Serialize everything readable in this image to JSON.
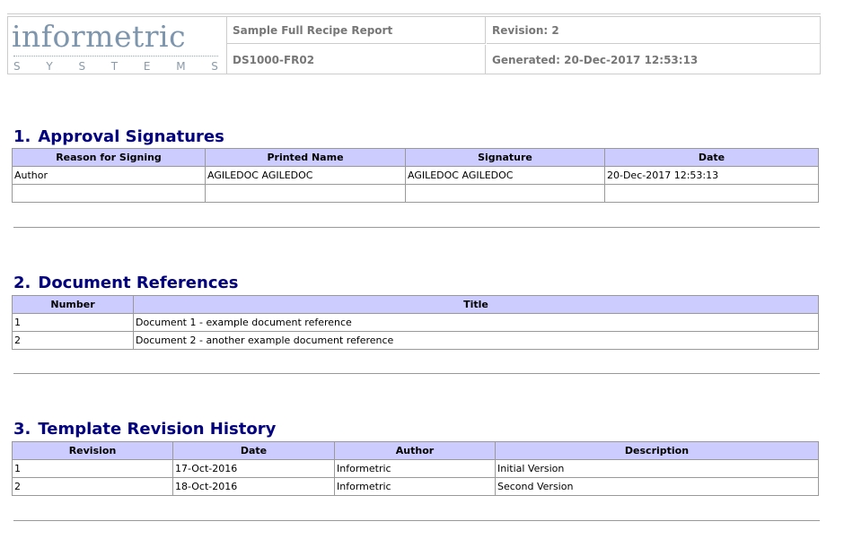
{
  "header": {
    "logo_word": "informetric",
    "logo_sub": [
      "S",
      "Y",
      "S",
      "T",
      "E",
      "M",
      "S"
    ],
    "report_title": "Sample Full Recipe Report",
    "revision": "Revision: 2",
    "doc_code": "DS1000-FR02",
    "generated": "Generated: 20-Dec-2017 12:53:13"
  },
  "sections": {
    "approval": {
      "number": "1.",
      "title": "Approval Signatures",
      "columns": [
        "Reason for Signing",
        "Printed Name",
        "Signature",
        "Date"
      ],
      "rows": [
        [
          "Author",
          "AGILEDOC AGILEDOC",
          "AGILEDOC AGILEDOC",
          "20-Dec-2017 12:53:13"
        ],
        [
          "",
          "",
          "",
          ""
        ]
      ]
    },
    "references": {
      "number": "2.",
      "title": "Document References",
      "columns": [
        "Number",
        "Title"
      ],
      "rows": [
        [
          "1",
          "Document 1 - example document reference"
        ],
        [
          "2",
          "Document 2 - another example document reference"
        ]
      ]
    },
    "history": {
      "number": "3.",
      "title": "Template Revision History",
      "columns": [
        "Revision",
        "Date",
        "Author",
        "Description"
      ],
      "rows": [
        [
          "1",
          "17-Oct-2016",
          "Informetric",
          "Initial Version"
        ],
        [
          "2",
          "18-Oct-2016",
          "Informetric",
          "Second Version"
        ]
      ]
    }
  },
  "colors": {
    "heading": "#00007f",
    "table_header_bg": "#ccccff",
    "logo": "#7d95ad"
  }
}
